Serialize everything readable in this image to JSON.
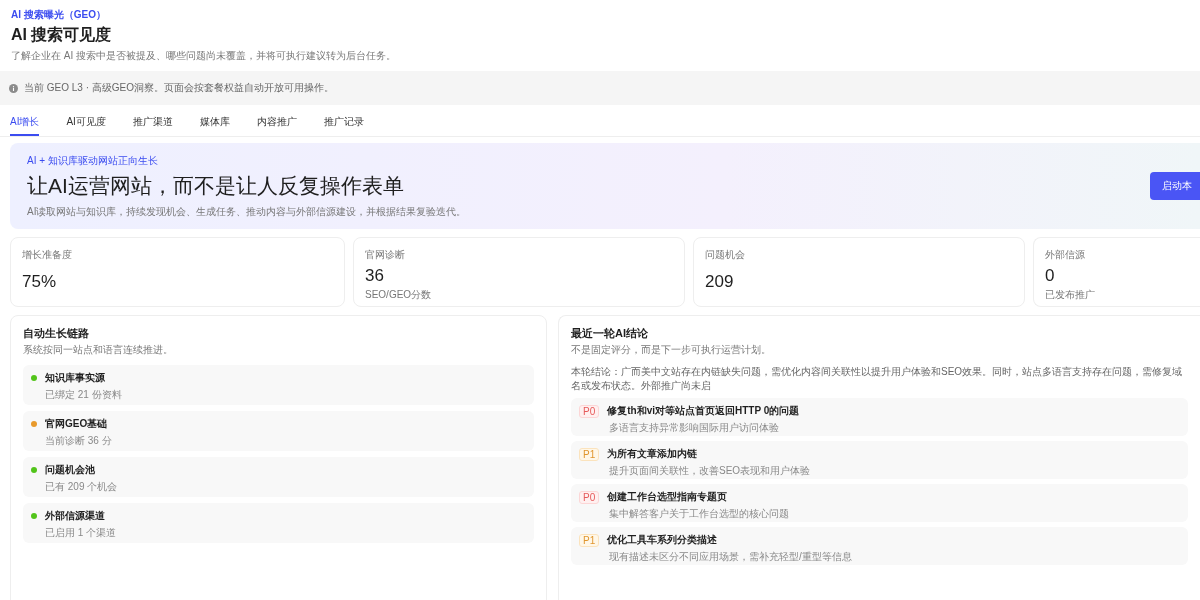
{
  "header": {
    "eyebrow": "AI 搜索曝光（GEO）",
    "title": "AI 搜索可见度",
    "subtitle": "了解企业在 AI 搜索中是否被提及、哪些问题尚未覆盖，并将可执行建议转为后台任务。"
  },
  "notice": "当前 GEO L3 · 高级GEO洞察。页面会按套餐权益自动开放可用操作。",
  "tabs": [
    {
      "label": "AI增长",
      "selected": true
    },
    {
      "label": "AI可见度",
      "selected": false
    },
    {
      "label": "推广渠道",
      "selected": false
    },
    {
      "label": "媒体库",
      "selected": false
    },
    {
      "label": "内容推广",
      "selected": false
    },
    {
      "label": "推广记录",
      "selected": false
    }
  ],
  "hero": {
    "eyebrow": "AI + 知识库驱动网站正向生长",
    "title": "让AI运营网站，而不是让人反复操作表单",
    "description": "AI读取网站与知识库，持续发现机会、生成任务、推动内容与外部信源建设，并根据结果复验迭代。",
    "button": "启动本"
  },
  "stats": [
    {
      "label": "增长准备度",
      "value": "75%"
    },
    {
      "label": "官网诊断",
      "value": "36",
      "note": "SEO/GEO分数"
    },
    {
      "label": "问题机会",
      "value": "209"
    },
    {
      "label": "外部信源",
      "value": "0",
      "note": "已发布推广"
    }
  ],
  "chain": {
    "title": "自动生长链路",
    "subtitle": "系统按同一站点和语言连续推进。",
    "steps": [
      {
        "title": "知识库事实源",
        "detail": "已绑定 21 份资料",
        "color": "#52c41a"
      },
      {
        "title": "官网GEO基础",
        "detail": "当前诊断 36 分",
        "color": "#e89a2c"
      },
      {
        "title": "问题机会池",
        "detail": "已有 209 个机会",
        "color": "#52c41a"
      },
      {
        "title": "外部信源渠道",
        "detail": "已启用 1 个渠道",
        "color": "#52c41a"
      }
    ]
  },
  "conclusion": {
    "title": "最近一轮AI结论",
    "subtitle": "不是固定评分，而是下一步可执行运营计划。",
    "summary": "本轮结论：广而美中文站存在内链缺失问题，需优化内容间关联性以提升用户体验和SEO效果。同时，站点多语言支持存在问题，需修复域名或发布状态。外部推广尚未启",
    "tasks": [
      {
        "kind": "p0",
        "priority": "P0",
        "title": "修复th和vi对等站点首页返回HTTP 0的问题",
        "detail": "多语言支持异常影响国际用户访问体验"
      },
      {
        "kind": "p1",
        "priority": "P1",
        "title": "为所有文章添加内链",
        "detail": "提升页面间关联性，改善SEO表现和用户体验"
      },
      {
        "kind": "p0",
        "priority": "P0",
        "title": "创建工作台选型指南专题页",
        "detail": "集中解答客户关于工作台选型的核心问题"
      },
      {
        "kind": "p1",
        "priority": "P1",
        "title": "优化工具车系列分类描述",
        "detail": "现有描述未区分不同应用场景，需补充轻型/重型等信息"
      }
    ]
  }
}
